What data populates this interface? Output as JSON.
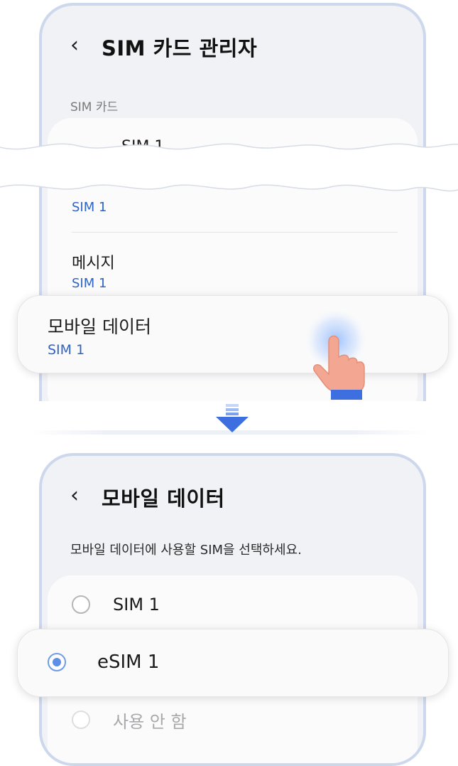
{
  "top_screen": {
    "back_icon": "chevron-left-icon",
    "title": "SIM 카드 관리자",
    "section_label": "SIM 카드",
    "sim_row_label": "SIM 1",
    "calls_value": "SIM 1",
    "messages_label": "메시지",
    "messages_value": "SIM 1",
    "mobile_data_label": "모바일 데이터",
    "mobile_data_value": "SIM 1"
  },
  "bottom_screen": {
    "back_icon": "chevron-left-icon",
    "title": "모바일 데이터",
    "description": "모바일 데이터에 사용할 SIM을 선택하세요.",
    "options": [
      {
        "label": "SIM 1",
        "selected": false
      },
      {
        "label": "eSIM 1",
        "selected": true
      },
      {
        "label": "사용 안 함",
        "selected": false
      }
    ]
  },
  "colors": {
    "accent_blue": "#2f63c4",
    "radio_selected": "#5e8fe6",
    "frame_border": "#cdd8ec",
    "arrow_blue": "#3d6fe0"
  }
}
